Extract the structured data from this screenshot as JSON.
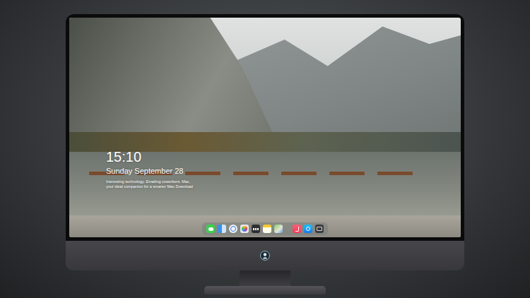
{
  "lock_screen": {
    "time": "15:10",
    "date": "Sunday September 28",
    "message_lines": [
      "Interesting technology. Emailing coworkers. Mac,",
      "your ideal companion for a smarter Mac Download"
    ]
  },
  "dock": {
    "apps": [
      {
        "kind": "messages"
      },
      {
        "kind": "finder"
      },
      {
        "kind": "safari"
      },
      {
        "kind": "photos"
      },
      {
        "kind": "video"
      },
      {
        "kind": "notes"
      },
      {
        "kind": "maps"
      },
      {
        "kind": "music"
      },
      {
        "kind": "appstore"
      },
      {
        "kind": "terminal"
      }
    ]
  }
}
